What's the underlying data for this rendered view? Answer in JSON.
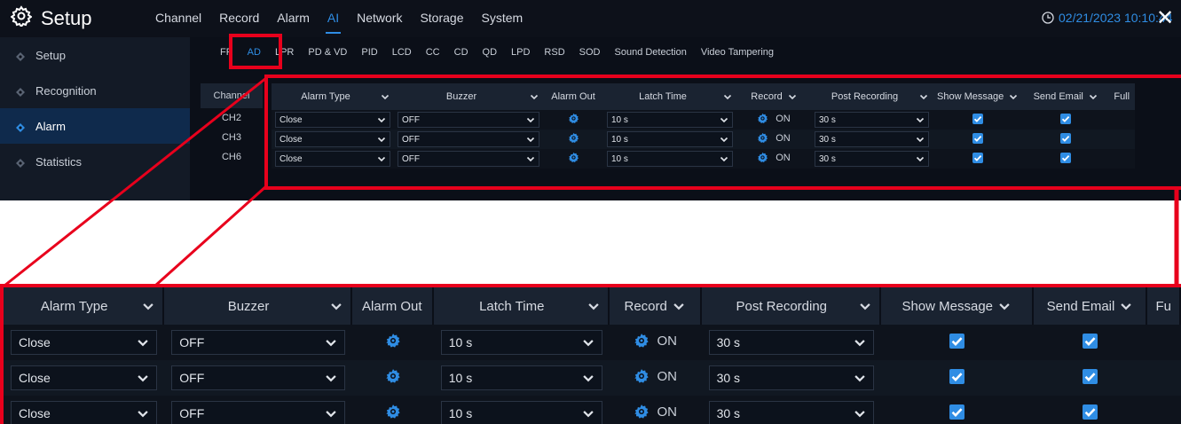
{
  "app": {
    "title": "Setup"
  },
  "main_nav": [
    "Channel",
    "Record",
    "Alarm",
    "AI",
    "Network",
    "Storage",
    "System"
  ],
  "main_nav_active": "AI",
  "datetime": "02/21/2023 10:10:44",
  "sidebar": [
    {
      "label": "Setup"
    },
    {
      "label": "Recognition"
    },
    {
      "label": "Alarm"
    },
    {
      "label": "Statistics"
    }
  ],
  "sidebar_active": "Alarm",
  "sub_tabs": [
    "FR",
    "AD",
    "LPR",
    "PD & VD",
    "PID",
    "LCD",
    "CC",
    "CD",
    "QD",
    "LPD",
    "RSD",
    "SOD",
    "Sound Detection",
    "Video Tampering"
  ],
  "sub_tab_active": "AD",
  "table": {
    "channel_header": "Channel",
    "headers": {
      "alarm_type": "Alarm Type",
      "buzzer": "Buzzer",
      "alarm_out": "Alarm Out",
      "latch_time": "Latch Time",
      "record": "Record",
      "post_recording": "Post Recording",
      "show_message": "Show Message",
      "send_email": "Send Email",
      "full": "Full",
      "full_cut": "Fu"
    },
    "rows": [
      {
        "channel": "CH2",
        "alarm_type": "Close",
        "buzzer": "OFF",
        "latch_time": "10 s",
        "record": "ON",
        "post_recording": "30 s",
        "show_message": true,
        "send_email": true
      },
      {
        "channel": "CH3",
        "alarm_type": "Close",
        "buzzer": "OFF",
        "latch_time": "10 s",
        "record": "ON",
        "post_recording": "30 s",
        "show_message": true,
        "send_email": true
      },
      {
        "channel": "CH6",
        "alarm_type": "Close",
        "buzzer": "OFF",
        "latch_time": "10 s",
        "record": "ON",
        "post_recording": "30 s",
        "show_message": true,
        "send_email": true
      }
    ]
  },
  "colors": {
    "accent": "#2f8de4",
    "highlight": "#e8001c",
    "background": "#0b0f18"
  },
  "icons": {
    "brand": "gear-icon",
    "clock": "clock-icon",
    "close": "close-icon",
    "alarm_out": "gear-icon",
    "dropdown": "chevron-down-icon",
    "checkbox": "checkbox-checked-icon"
  }
}
